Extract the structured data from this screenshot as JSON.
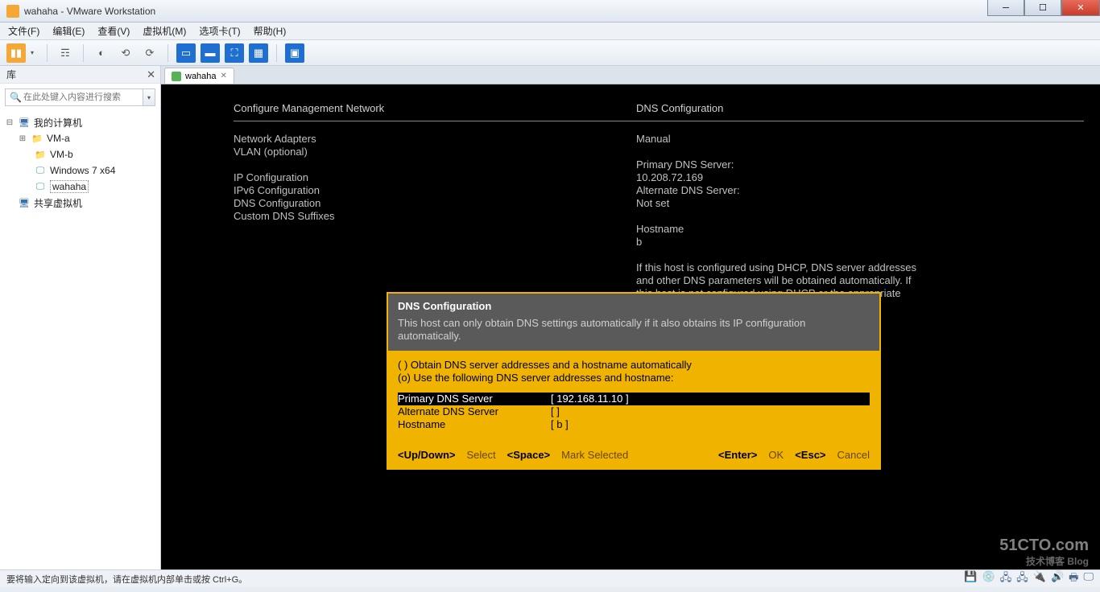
{
  "window": {
    "title": "wahaha - VMware Workstation",
    "menu": [
      "文件(F)",
      "编辑(E)",
      "查看(V)",
      "虚拟机(M)",
      "选项卡(T)",
      "帮助(H)"
    ]
  },
  "sidebar": {
    "header": "库",
    "search_placeholder": "在此处键入内容进行搜索",
    "root": "我的计算机",
    "items": [
      "VM-a",
      "VM-b",
      "Windows 7 x64",
      "wahaha"
    ],
    "shared": "共享虚拟机"
  },
  "tab": {
    "label": "wahaha"
  },
  "console": {
    "title_left": "Configure Management Network",
    "title_right": "DNS Configuration",
    "left_lines": "Network Adapters\nVLAN (optional)\n\nIP Configuration\nIPv6 Configuration\nDNS Configuration\nCustom DNS Suffixes",
    "right_lines": "Manual\n\nPrimary DNS Server:\n10.208.72.169\nAlternate DNS Server:\nNot set\n\nHostname\nb\n\nIf this host is configured using DHCP, DNS server addresses\nand other DNS parameters will be obtained automatically. If\nthis host is not configured using DHCP or the appropriate"
  },
  "dialog": {
    "title": "DNS Configuration",
    "subtitle": "This host can only obtain DNS settings automatically if it also obtains its IP configuration automatically.",
    "opt1": "( ) Obtain DNS server addresses and a hostname automatically",
    "opt2": "(o) Use the following DNS server addresses and hostname:",
    "fields": [
      {
        "label": "Primary DNS Server",
        "value": "[ 192.168.11.10                            ]",
        "sel": true
      },
      {
        "label": "Alternate DNS Server",
        "value": "[                                          ]",
        "sel": false
      },
      {
        "label": "Hostname",
        "value": "[ b                                        ]",
        "sel": false
      }
    ],
    "foot": {
      "k1": "<Up/Down>",
      "a1": "Select",
      "k2": "<Space>",
      "a2": "Mark Selected",
      "k3": "<Enter>",
      "a3": "OK",
      "k4": "<Esc>",
      "a4": "Cancel"
    }
  },
  "status": "要将输入定向到该虚拟机，请在虚拟机内部单击或按 Ctrl+G。",
  "watermark": {
    "l1": "51CTO.com",
    "l2": "技术博客  Blog"
  }
}
